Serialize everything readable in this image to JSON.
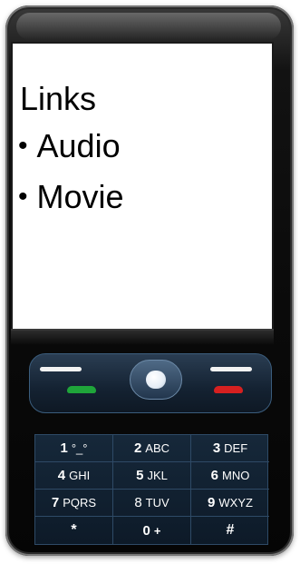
{
  "screen": {
    "title": "Links",
    "bullet": "•",
    "items": [
      "Audio",
      "Movie"
    ]
  },
  "keypad": {
    "keys": [
      {
        "num": "1",
        "letters": "°_°"
      },
      {
        "num": "2",
        "letters": "ABC"
      },
      {
        "num": "3",
        "letters": "DEF"
      },
      {
        "num": "4",
        "letters": "GHI"
      },
      {
        "num": "5",
        "letters": "JKL"
      },
      {
        "num": "6",
        "letters": "MNO"
      },
      {
        "num": "7",
        "letters": "PQRS"
      },
      {
        "num": "8",
        "letters": "TUV"
      },
      {
        "num": "9",
        "letters": "WXYZ"
      },
      {
        "num": "*",
        "letters": ""
      },
      {
        "num": "0",
        "letters": "+"
      },
      {
        "num": "#",
        "letters": ""
      }
    ]
  },
  "colors": {
    "call_button": "#1fa53a",
    "end_button": "#d62020",
    "keypad_bg": "#142232"
  }
}
